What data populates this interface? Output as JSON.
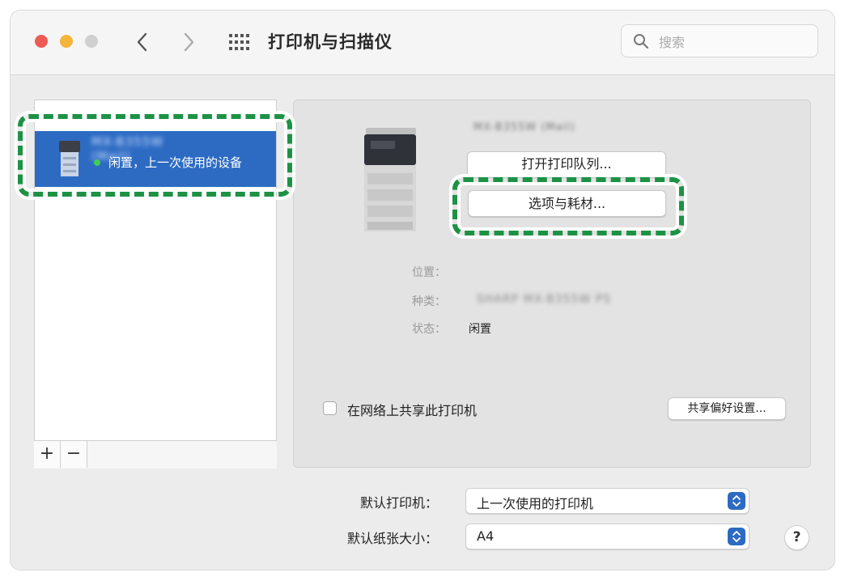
{
  "window": {
    "title": "打印机与扫描仪",
    "search_placeholder": "搜索"
  },
  "sidebar": {
    "printer_name": "MX-B355W (Mail)",
    "printer_status": "闲置，上一次使用的设备",
    "add_label": "+",
    "remove_label": "−"
  },
  "detail": {
    "printer_name": "MX-B355W (Mail)",
    "open_queue_label": "打开打印队列...",
    "options_supplies_label": "选项与耗材...",
    "location_label": "位置：",
    "location_value": "",
    "kind_label": "种类：",
    "kind_value": "SHARP MX-B355W PS",
    "status_label": "状态：",
    "status_value": "闲置",
    "share_label": "在网络上共享此打印机",
    "share_checked": false,
    "share_prefs_label": "共享偏好设置..."
  },
  "footer": {
    "default_printer_label": "默认打印机：",
    "default_printer_value": "上一次使用的打印机",
    "default_paper_label": "默认纸张大小：",
    "default_paper_value": "A4",
    "help_label": "?"
  },
  "colors": {
    "accent": "#2d6bc3",
    "highlight_ring": "#1d9245",
    "status_dot": "#3fcf55"
  }
}
